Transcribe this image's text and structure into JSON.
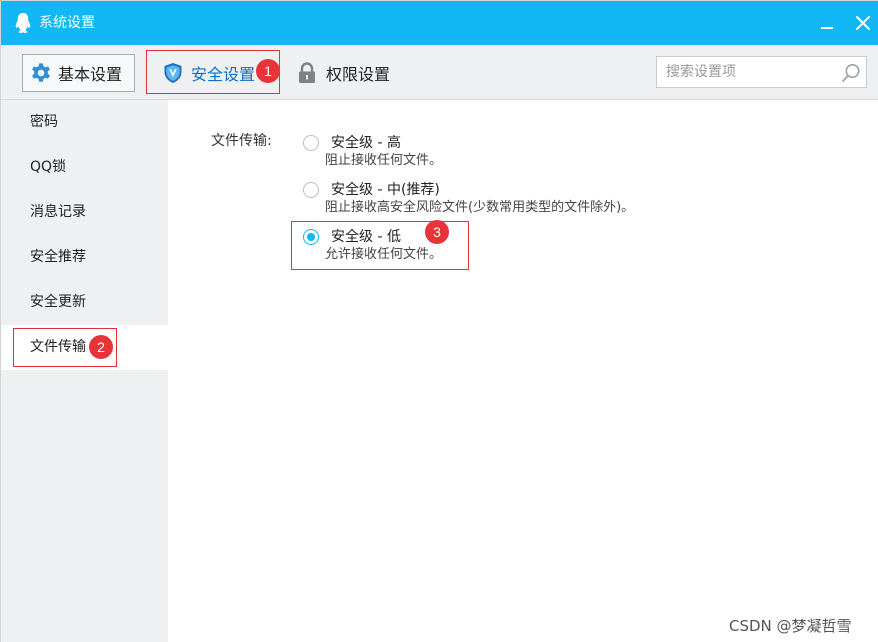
{
  "window": {
    "title": "系统设置",
    "accent_color": "#12b7f5",
    "icons": {
      "app": "qq-penguin-icon",
      "minimize": "minimize-icon",
      "close": "close-icon"
    }
  },
  "toolbar": {
    "basic_label": "基本设置",
    "security_label": "安全设置",
    "permissions_label": "权限设置",
    "search_placeholder": "搜索设置项",
    "icons": {
      "basic": "gear-icon",
      "security": "shield-icon",
      "permissions": "lock-icon",
      "search": "search-icon"
    }
  },
  "sidebar": {
    "items": [
      {
        "label": "密码",
        "active": false
      },
      {
        "label": "QQ锁",
        "active": false
      },
      {
        "label": "消息记录",
        "active": false
      },
      {
        "label": "安全推荐",
        "active": false
      },
      {
        "label": "安全更新",
        "active": false
      },
      {
        "label": "文件传输",
        "active": true
      }
    ]
  },
  "content": {
    "section_label": "文件传输:",
    "options": [
      {
        "title": "安全级 - 高",
        "desc": "阻止接收任何文件。",
        "checked": false
      },
      {
        "title": "安全级 - 中(推荐)",
        "desc": "阻止接收高安全风险文件(少数常用类型的文件除外)。",
        "checked": false
      },
      {
        "title": "安全级 - 低",
        "desc": "允许接收任何文件。",
        "checked": true
      }
    ]
  },
  "annotations": {
    "badges": [
      "1",
      "2",
      "3"
    ],
    "color": "#e8333b"
  },
  "watermark": "CSDN @梦凝哲雪"
}
